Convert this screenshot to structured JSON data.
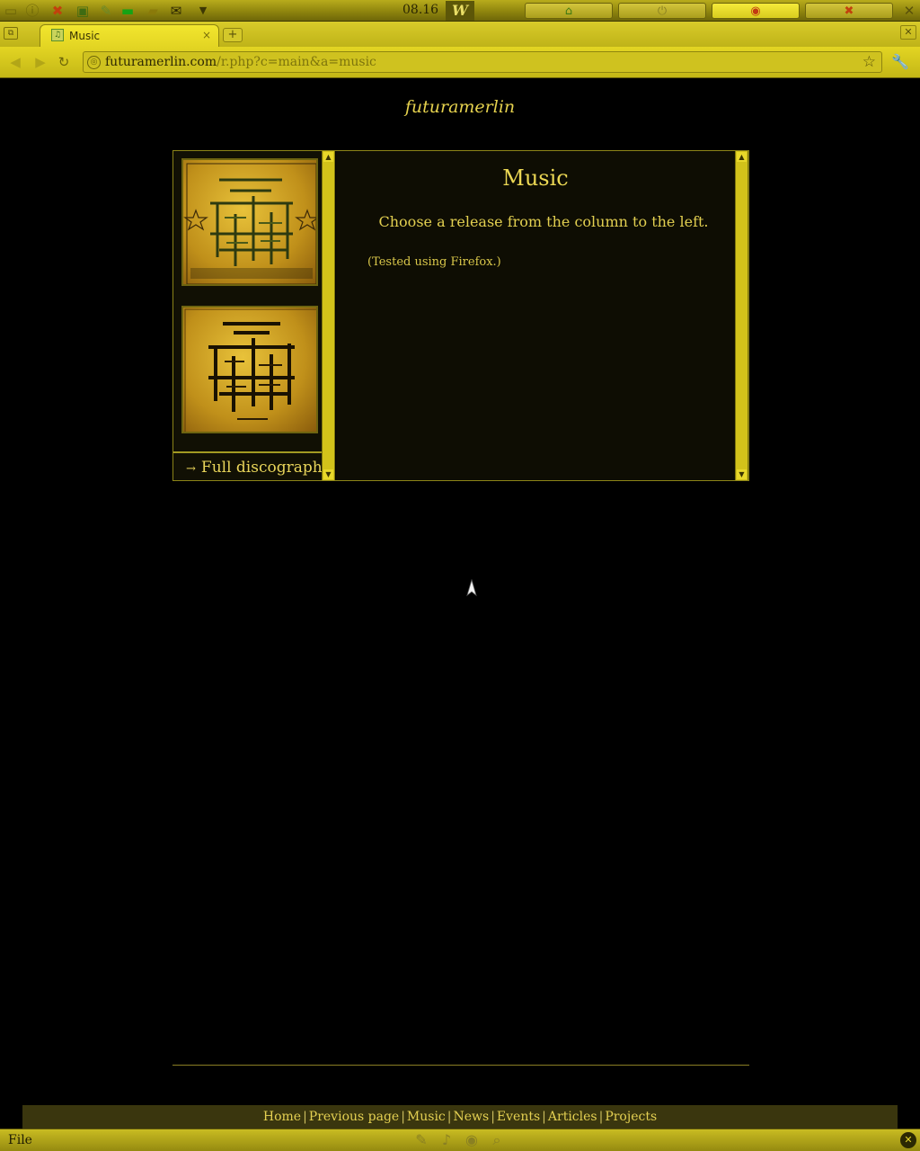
{
  "system_panel": {
    "clock": "08.16",
    "launcher_letter": "W",
    "icons": [
      "window-icon",
      "info-icon",
      "tools-icon",
      "screenshot-icon",
      "pencil-icon",
      "battery-icon",
      "folder-icon",
      "mail-icon",
      "dropdown-icon"
    ],
    "tasks": [
      "home-icon",
      "power-icon",
      "chrome-icon",
      "close-x-icon"
    ]
  },
  "browser": {
    "tab": {
      "title": "Music",
      "close_glyph": "×"
    },
    "new_tab_glyph": "+",
    "window_close_glyph": "✕",
    "address": {
      "domain": "futuramerlin.com",
      "path": "/r.php?c=main&a=music"
    }
  },
  "page": {
    "site_title": "futuramerlin",
    "heading": "Music",
    "intro": "Choose a release from the column to the left.",
    "note": "(Tested using Firefox.)",
    "sidebar": {
      "albums": [
        "album-cover-1",
        "album-cover-2"
      ],
      "discography_arrow": "→",
      "discography_label": "Full discography"
    },
    "footer_links": [
      "Home",
      "Previous page",
      "Music",
      "News",
      "Events",
      "Articles",
      "Projects"
    ]
  },
  "bottom_panel": {
    "menu_label": "File"
  },
  "colors": {
    "accent": "#e8d45a",
    "chrome_yellow": "#e3d523",
    "page_background": "#000000"
  }
}
